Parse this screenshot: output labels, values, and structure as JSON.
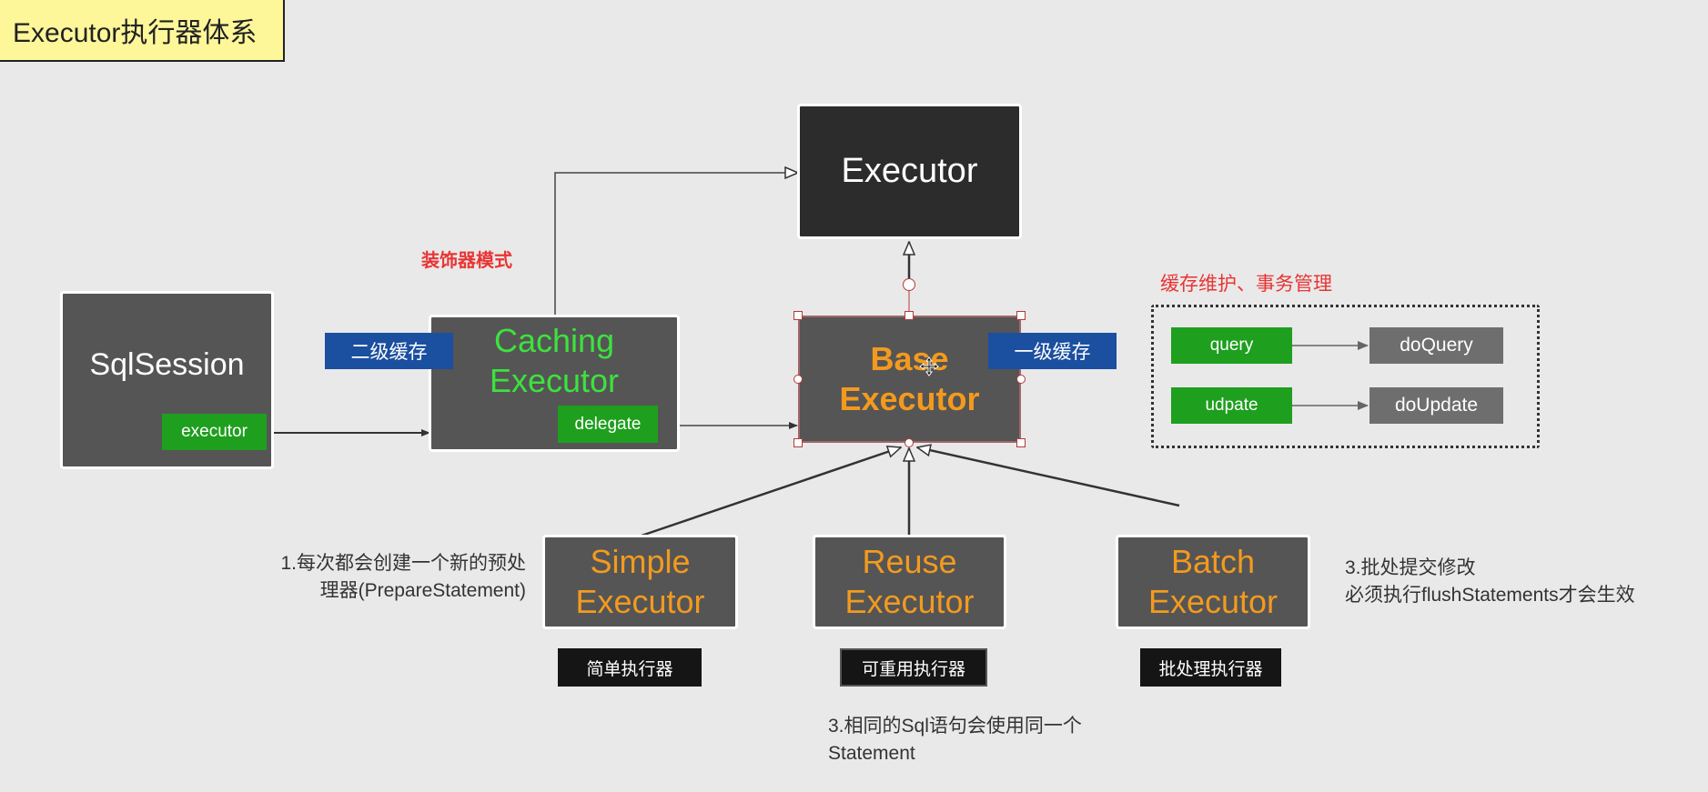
{
  "title": "Executor执行器体系",
  "decorator_label": "装饰器模式",
  "cache_note": "缓存维护、事务管理",
  "executor_box": {
    "label": "Executor"
  },
  "sqlsession": {
    "label": "SqlSession",
    "field": "executor"
  },
  "caching": {
    "line1": "Caching",
    "line2": "Executor",
    "field": "delegate",
    "tag": "二级缓存"
  },
  "base": {
    "line1": "Base",
    "line2": "Executor",
    "tag": "一级缓存"
  },
  "methods": [
    {
      "name": "query",
      "impl": "doQuery"
    },
    {
      "name": "udpate",
      "impl": "doUpdate"
    }
  ],
  "children": [
    {
      "line1": "Simple",
      "line2": "Executor",
      "caption": "简单执行器"
    },
    {
      "line1": "Reuse",
      "line2": "Executor",
      "caption": "可重用执行器"
    },
    {
      "line1": "Batch",
      "line2": "Executor",
      "caption": "批处理执行器"
    }
  ],
  "notes": {
    "simple_line1": "1.每次都会创建一个新的预处",
    "simple_line2": "理器(PrepareStatement)",
    "batch_line1": "3.批处提交修改",
    "batch_line2": "必须执行flushStatements才会生效",
    "reuse_line1": "3.相同的Sql语句会使用同一个",
    "reuse_line2": "Statement"
  },
  "colors": {
    "background": "#e9e9e9",
    "title_bg": "#fdf79a",
    "box_dark": "#555555",
    "executor_bg": "#2c2c2c",
    "green_tag": "#1e9f1e",
    "blue_tag": "#1b4fa0",
    "orange_text": "#f39a1e",
    "green_text": "#3de23d",
    "red_text": "#e93434"
  }
}
